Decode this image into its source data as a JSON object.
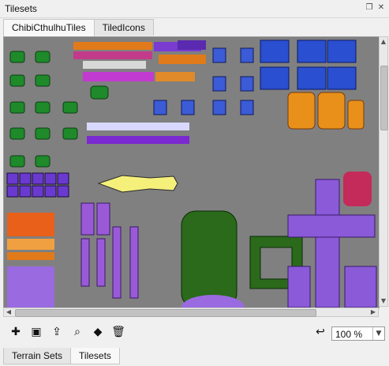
{
  "window": {
    "title": "Tilesets"
  },
  "tabs": [
    {
      "label": "ChibiCthulhuTiles",
      "active": true
    },
    {
      "label": "TiledIcons",
      "active": false
    }
  ],
  "toolbar": {
    "zoom": "100 %"
  },
  "bottom_tabs": [
    {
      "label": "Terrain Sets",
      "active": false
    },
    {
      "label": "Tilesets",
      "active": true
    }
  ],
  "icons": {
    "float": "float-window-icon",
    "close": "close-icon",
    "new": "new-tileset-icon",
    "embed": "embed-tileset-icon",
    "export": "export-tileset-icon",
    "props": "tileset-properties-icon",
    "terrain": "edit-terrain-icon",
    "remove": "remove-tileset-icon",
    "undo": "dynamic-wrapping-icon"
  },
  "colors": {
    "viewport_bg": "#808080",
    "green_tile": "#1e8a2a",
    "blue_tile": "#2a5bd7",
    "purple_tile": "#8a5bd0",
    "orange_tile": "#e07a1a"
  }
}
